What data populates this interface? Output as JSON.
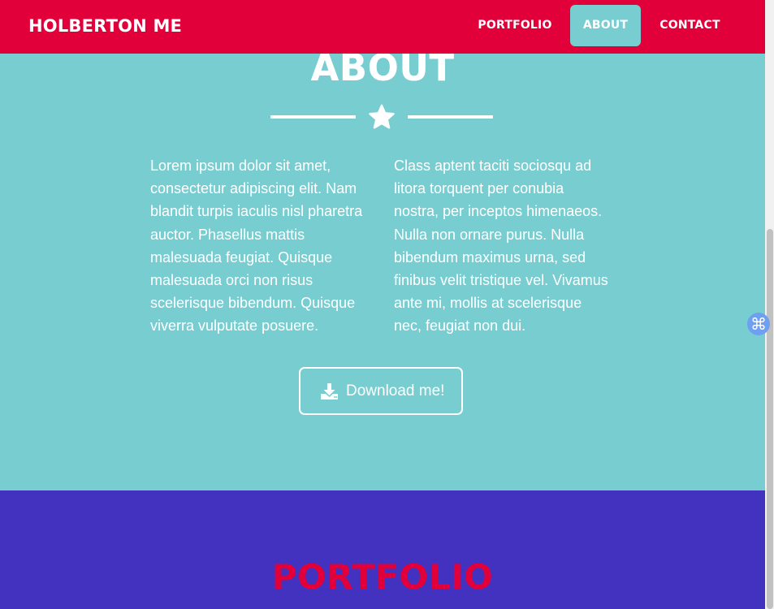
{
  "navbar": {
    "brand": "HOLBERTON ME",
    "items": [
      {
        "label": "PORTFOLIO",
        "active": false
      },
      {
        "label": "ABOUT",
        "active": true
      },
      {
        "label": "CONTACT",
        "active": false
      }
    ]
  },
  "about": {
    "title": "ABOUT",
    "divider_icon": "star-icon",
    "col_left": "Lorem ipsum dolor sit amet, consectetur adipiscing elit. Nam blandit turpis iaculis nisl pharetra auctor. Phasellus mattis malesuada feugiat. Quisque malesuada orci non risus scelerisque bibendum. Quisque viverra vulputate posuere.",
    "col_right": "Class aptent taciti sociosqu ad litora torquent per conubia nostra, per inceptos himenaeos. Nulla non ornare purus. Nulla bibendum maximus urna, sed finibus velit tristique vel. Vivamus ante mi, mollis at scelerisque nec, feugiat non dui.",
    "download": {
      "label": "Download me!",
      "icon": "download-icon"
    }
  },
  "portfolio": {
    "title": "PORTFOLIO"
  },
  "extension": {
    "glyph": "⌘",
    "icon": "command-icon"
  },
  "colors": {
    "navbar": "#e1003a",
    "about_bg": "#78cdd1",
    "portfolio_bg": "#4232bf",
    "portfolio_title": "#e1003a",
    "text": "#ffffff"
  }
}
